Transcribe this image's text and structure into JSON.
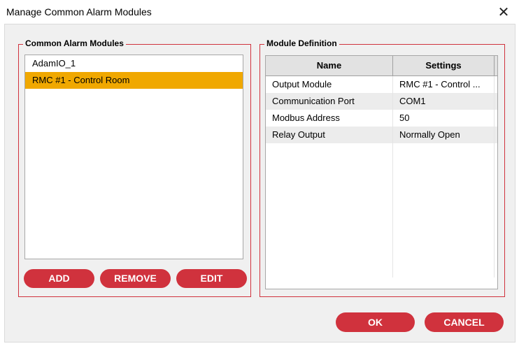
{
  "window": {
    "title": "Manage Common Alarm Modules",
    "close_glyph": "✕"
  },
  "modules_panel": {
    "title": "Common Alarm Modules",
    "items": [
      {
        "label": "AdamIO_1",
        "selected": false
      },
      {
        "label": "RMC #1 - Control Room",
        "selected": true
      }
    ],
    "buttons": {
      "add": "ADD",
      "remove": "REMOVE",
      "edit": "EDIT"
    }
  },
  "definition_panel": {
    "title": "Module Definition",
    "columns": [
      "Name",
      "Settings"
    ],
    "rows": [
      {
        "name": "Output Module",
        "value": "RMC #1 - Control ..."
      },
      {
        "name": "Communication Port",
        "value": "COM1"
      },
      {
        "name": "Modbus Address",
        "value": "50"
      },
      {
        "name": "Relay Output",
        "value": "Normally Open"
      }
    ]
  },
  "dialog_buttons": {
    "ok": "OK",
    "cancel": "CANCEL"
  },
  "colors": {
    "accent_red": "#d0323d",
    "selection": "#f0a800"
  }
}
